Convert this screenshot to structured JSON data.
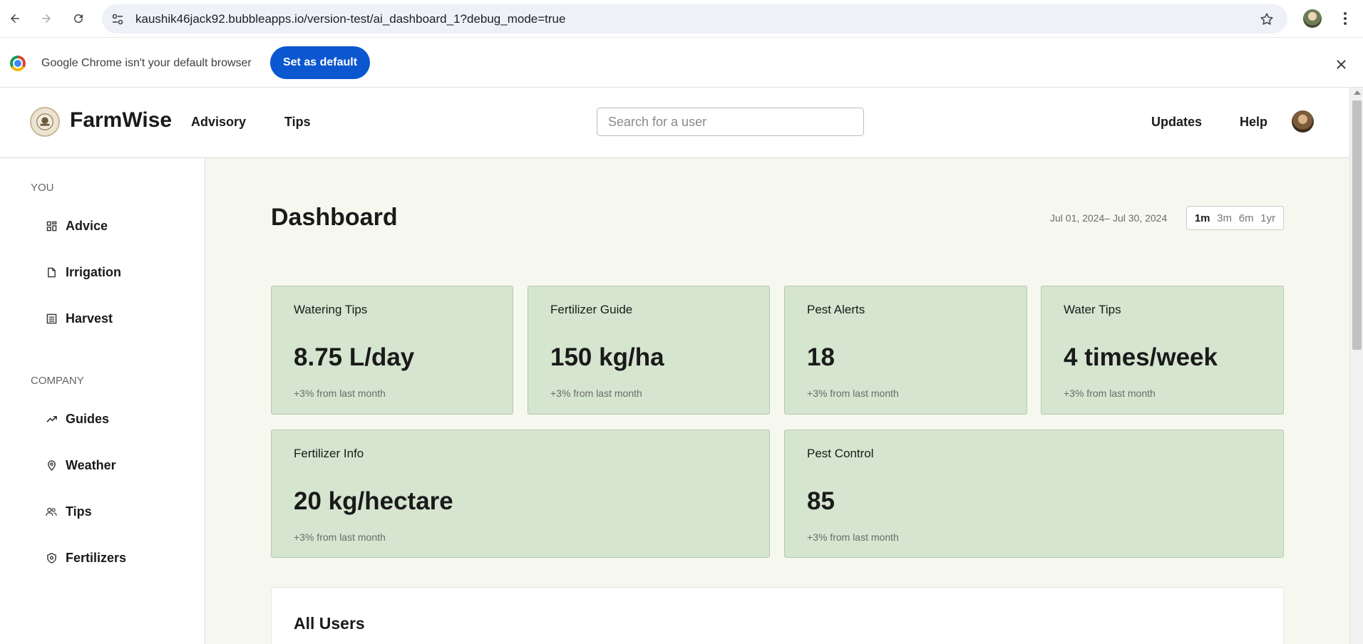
{
  "browser": {
    "url": "kaushik46jack92.bubbleapps.io/version-test/ai_dashboard_1?debug_mode=true",
    "infobar_text": "Google Chrome isn't your default browser",
    "set_default_label": "Set as default"
  },
  "header": {
    "brand": "FarmWise",
    "nav": [
      "Advisory",
      "Tips"
    ],
    "search_placeholder": "Search for a user",
    "right_nav": [
      "Updates",
      "Help"
    ]
  },
  "sidebar": {
    "sections": [
      {
        "label": "YOU",
        "items": [
          {
            "label": "Advice",
            "icon": "grid-icon"
          },
          {
            "label": "Irrigation",
            "icon": "document-icon"
          },
          {
            "label": "Harvest",
            "icon": "list-icon"
          }
        ]
      },
      {
        "label": "COMPANY",
        "items": [
          {
            "label": "Guides",
            "icon": "trend-icon"
          },
          {
            "label": "Weather",
            "icon": "location-pin-icon"
          },
          {
            "label": "Tips",
            "icon": "users-icon"
          },
          {
            "label": "Fertilizers",
            "icon": "shield-icon"
          }
        ]
      }
    ]
  },
  "main": {
    "title": "Dashboard",
    "date_range": "Jul 01, 2024– Jul 30, 2024",
    "ranges": [
      "1m",
      "3m",
      "6m",
      "1yr"
    ],
    "active_range": "1m",
    "cards": [
      {
        "title": "Watering Tips",
        "value": "8.75 L/day",
        "change": "+3% from last month"
      },
      {
        "title": "Fertilizer Guide",
        "value": "150 kg/ha",
        "change": "+3% from last month"
      },
      {
        "title": "Pest Alerts",
        "value": "18",
        "change": "+3% from last month"
      },
      {
        "title": "Water Tips",
        "value": "4 times/week",
        "change": "+3% from last month"
      },
      {
        "title": "Fertilizer Info",
        "value": "20 kg/hectare",
        "change": "+3% from last month"
      },
      {
        "title": "Pest Control",
        "value": "85",
        "change": "+3% from last month"
      }
    ],
    "users_title": "All Users"
  }
}
